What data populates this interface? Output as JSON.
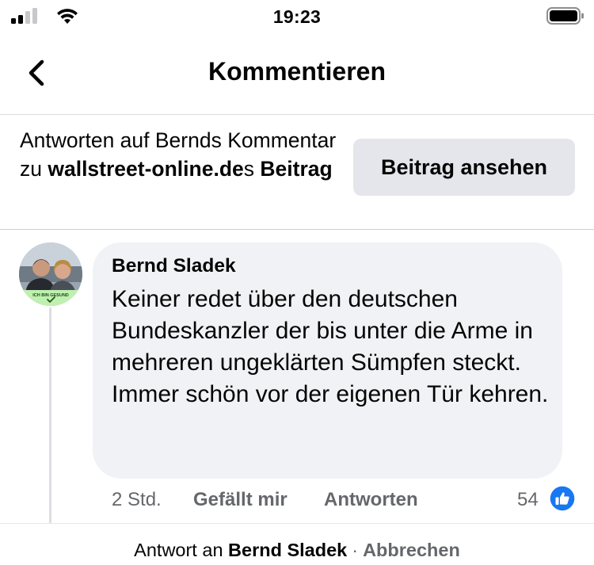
{
  "status_bar": {
    "time": "19:23",
    "icons": [
      "cellular-signal-icon",
      "wifi-icon",
      "battery-icon"
    ]
  },
  "header": {
    "title": "Kommentieren",
    "back_icon": "chevron-left-icon"
  },
  "context": {
    "prefix": "Antworten auf Bernds Kommentar zu ",
    "page_name": "wallstreet-online.de",
    "suffix_s": "s ",
    "post_word": "Beitrag",
    "view_post_label": "Beitrag ansehen"
  },
  "comment": {
    "author": "Bernd Sladek",
    "avatar_badge": "ICH BIN GESUND",
    "text": "Keiner redet über den deutschen Bundeskanzler der bis unter die Arme in mehreren ungeklärten Sümpfen steckt.\nImmer schön vor der eigenen Tür kehren.",
    "time": "2 Std.",
    "like_label": "Gefällt mir",
    "reply_label": "Antworten",
    "like_count": "54",
    "reaction_icon": "thumbs-up-icon"
  },
  "reply_bar": {
    "prefix": "Antwort an",
    "name": "Bernd Sladek",
    "separator": "·",
    "cancel_label": "Abbrechen"
  },
  "colors": {
    "accent_blue": "#1877f2",
    "bubble_bg": "#f0f2f5",
    "button_bg": "#e4e6eb",
    "secondary_text": "#65676b"
  }
}
